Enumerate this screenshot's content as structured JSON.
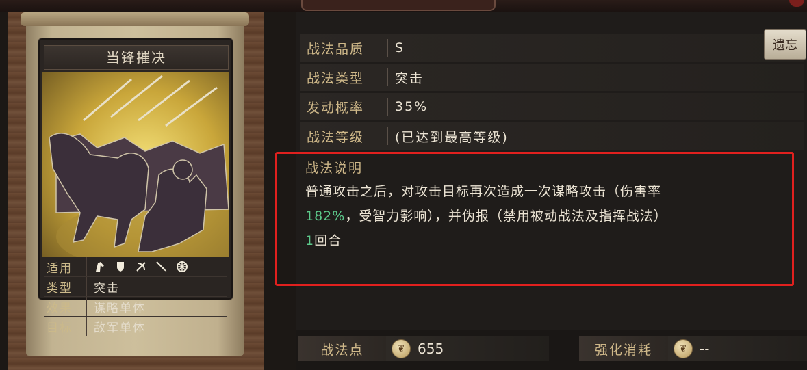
{
  "card": {
    "title": "当锋摧决",
    "rows": [
      {
        "key": "适用",
        "icons": [
          "cavalry-icon",
          "shield-icon",
          "bow-icon",
          "spear-icon",
          "wheel-icon"
        ]
      },
      {
        "key": "类型",
        "value": "突击"
      },
      {
        "key": "效果",
        "value": "谋略单体"
      },
      {
        "key": "目标",
        "value": "敌军单体"
      }
    ]
  },
  "info": {
    "quality": {
      "label": "战法品质",
      "value": "S"
    },
    "type": {
      "label": "战法类型",
      "value": "突击"
    },
    "rate": {
      "label": "发动概率",
      "value": "35%"
    },
    "level": {
      "label": "战法等级",
      "value": "(已达到最高等级)"
    }
  },
  "detail_button": {
    "label": "遗忘"
  },
  "description": {
    "title": "战法说明",
    "line1": "普通攻击之后，对攻击目标再次造成一次谋略攻击（伤害率",
    "line2_green": "182%",
    "line2_rest": "，受智力影响），并伪报（禁用被动战法及指挥战法）",
    "line3_green": "1",
    "line3_rest": "回合"
  },
  "footer": {
    "points_label": "战法点",
    "points_value": "655",
    "upgrade_label": "强化消耗",
    "upgrade_value": "--"
  },
  "colors": {
    "highlight": "#e0201e",
    "accent_green": "#5cc98a",
    "label_gold": "#cfb889"
  }
}
